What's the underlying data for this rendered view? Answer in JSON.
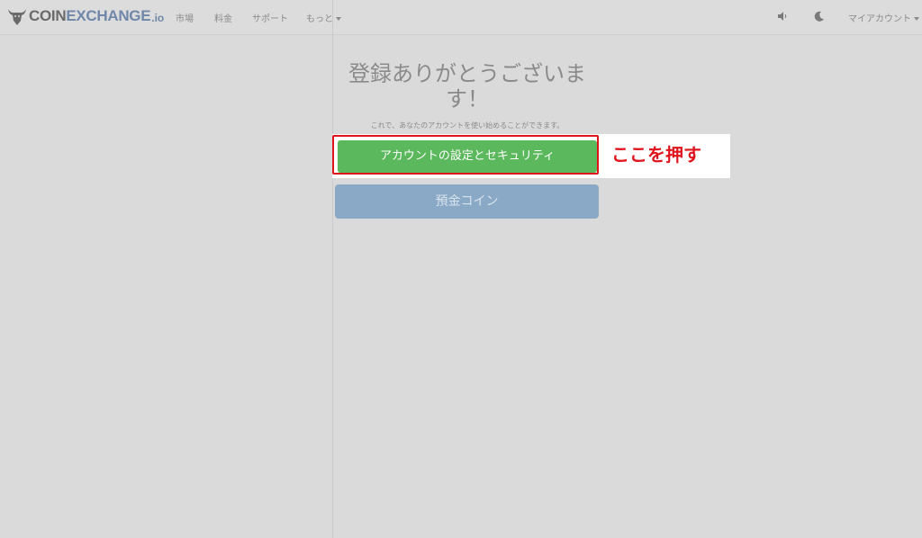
{
  "header": {
    "logo": {
      "part1": "COIN",
      "part2": "EXCHANGE",
      "part3": ".io"
    },
    "nav": {
      "markets": "市場",
      "fees": "料金",
      "support": "サポート",
      "more": "もっと"
    },
    "account_label": "マイアカウント",
    "icons": [
      "volume-icon",
      "moon-icon"
    ]
  },
  "main": {
    "title_line1": "登録ありがとうございま",
    "title_line2": "す！",
    "subtitle": "これで、あなたのアカウントを使い始めることができます。",
    "primary_button": "アカウントの設定とセキュリティ",
    "secondary_button": "預金コイン",
    "annotation": "ここを押す"
  },
  "colors": {
    "background": "#dadada",
    "primary_button": "#5cb85c",
    "secondary_button": "#8aa9c6",
    "annotation_red": "#e0141c",
    "logo_blue": "#6f87a8"
  }
}
